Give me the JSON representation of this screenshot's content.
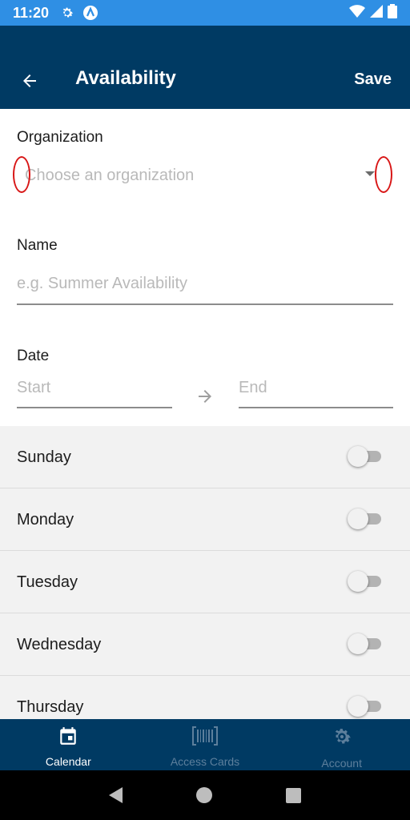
{
  "status_bar": {
    "time": "11:20",
    "icons": [
      "gear-icon",
      "app-a-icon",
      "wifi-icon",
      "signal-icon",
      "battery-icon"
    ],
    "color": "#2f8fe4"
  },
  "app_bar": {
    "title": "Availability",
    "save_label": "Save",
    "back_icon": "arrow-left-icon",
    "color": "#003a63"
  },
  "form": {
    "organization": {
      "label": "Organization",
      "placeholder": "Choose an organization"
    },
    "name": {
      "label": "Name",
      "placeholder": "e.g. Summer Availability"
    },
    "date": {
      "label": "Date",
      "start_placeholder": "Start",
      "end_placeholder": "End"
    }
  },
  "days": [
    {
      "label": "Sunday",
      "enabled": false
    },
    {
      "label": "Monday",
      "enabled": false
    },
    {
      "label": "Tuesday",
      "enabled": false
    },
    {
      "label": "Wednesday",
      "enabled": false
    },
    {
      "label": "Thursday",
      "enabled": false
    }
  ],
  "bottom_nav": {
    "items": [
      {
        "label": "Calendar",
        "icon": "calendar-icon",
        "active": true
      },
      {
        "label": "Access Cards",
        "icon": "barcode-icon",
        "active": false
      },
      {
        "label": "Account",
        "icon": "gear-icon",
        "active": false
      }
    ]
  },
  "system_nav": {
    "icons": [
      "back-triangle-icon",
      "home-circle-icon",
      "recents-square-icon"
    ]
  }
}
